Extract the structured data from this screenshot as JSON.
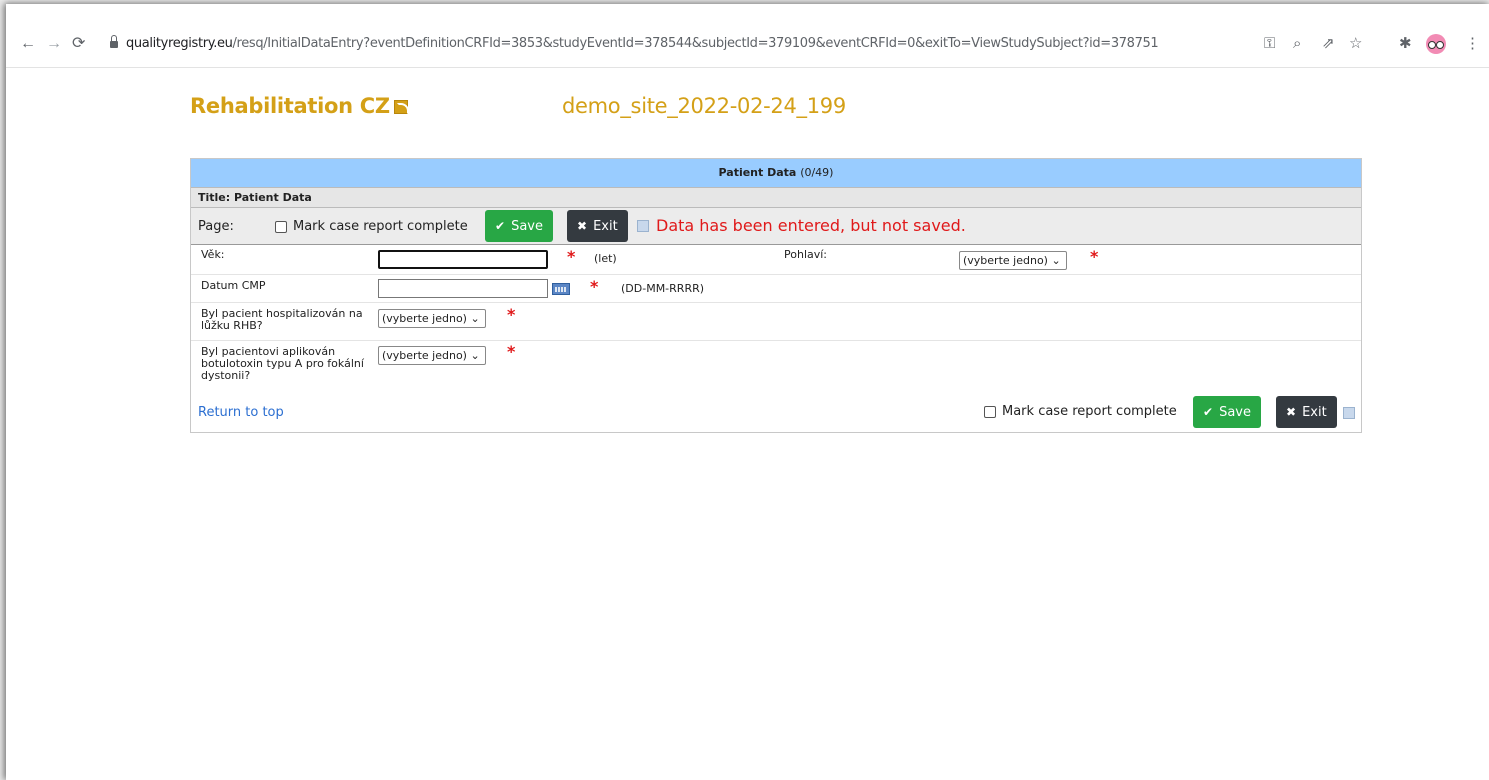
{
  "browser": {
    "url_host": "qualityregistry.eu",
    "url_rest": "/resq/InitialDataEntry?eventDefinitionCRFId=3853&studyEventId=378544&subjectId=379109&eventCRFId=0&exitTo=ViewStudySubject?id=378751"
  },
  "study": {
    "title": "Rehabilitation CZ",
    "site": "demo_site_2022-02-24_199"
  },
  "crf": {
    "header_title": "Patient Data",
    "header_count": "(0/49)",
    "section_title": "Title: Patient Data",
    "page_label": "Page:",
    "mark_complete_label": "Mark case report complete",
    "save_label": "Save",
    "exit_label": "Exit",
    "warning": "Data has been entered, but not saved."
  },
  "fields": {
    "vek": {
      "label": "Věk:",
      "value": "",
      "hint": "(let)"
    },
    "pohlavi": {
      "label": "Pohlaví:",
      "selected": "(vyberte jedno)"
    },
    "datum_cmp": {
      "label": "Datum CMP",
      "value": "",
      "hint": "(DD-MM-RRRR)"
    },
    "hospitalizovan": {
      "label": "Byl pacient hospitalizován na lůžku RHB?",
      "selected": "(vyberte jedno)"
    },
    "botulotoxin": {
      "label": "Byl pacientovi aplikován botulotoxin typu A pro fokální dystonii?",
      "selected": "(vyberte jedno)"
    },
    "required_mark": "*"
  },
  "footer": {
    "return_to_top": "Return to top",
    "mark_complete_label": "Mark case report complete",
    "save_label": "Save",
    "exit_label": "Exit"
  }
}
